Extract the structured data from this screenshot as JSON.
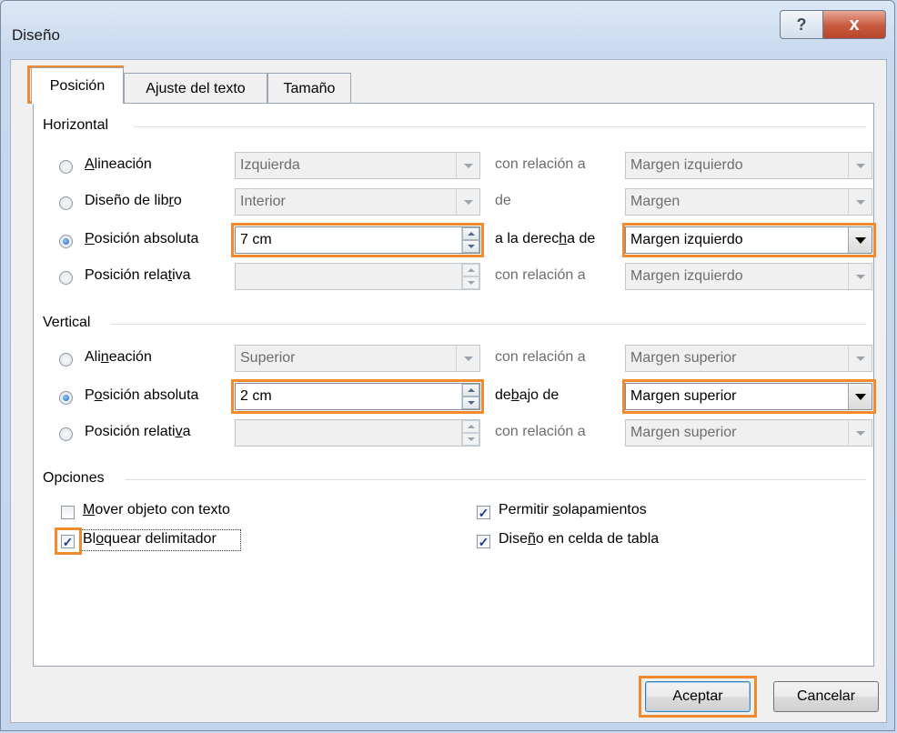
{
  "window": {
    "title": "Diseño",
    "help_label": "?",
    "close_label": "x"
  },
  "tabs": [
    {
      "label": "Posición",
      "active": true
    },
    {
      "label": "Ajuste del texto",
      "active": false
    },
    {
      "label": "Tamaño",
      "active": false
    }
  ],
  "horizontal": {
    "label": "Horizontal",
    "rows": [
      {
        "option": "Alineación",
        "selected": false,
        "value": "Izquierda",
        "relation": "con relación a",
        "reference": "Margen izquierdo"
      },
      {
        "option": "Diseño de libro",
        "selected": false,
        "value": "Interior",
        "relation": "de",
        "reference": "Margen"
      },
      {
        "option": "Posición absoluta",
        "selected": true,
        "value": "7 cm",
        "relation": "a la derecha de",
        "reference": "Margen izquierdo"
      },
      {
        "option": "Posición relativa",
        "selected": false,
        "value": "",
        "relation": "con relación a",
        "reference": "Margen izquierdo"
      }
    ]
  },
  "vertical": {
    "label": "Vertical",
    "rows": [
      {
        "option": "Alineación",
        "selected": false,
        "value": "Superior",
        "relation": "con relación a",
        "reference": "Margen superior"
      },
      {
        "option": "Posición absoluta",
        "selected": true,
        "value": "2 cm",
        "relation": "debajo de",
        "reference": "Margen superior"
      },
      {
        "option": "Posición relativa",
        "selected": false,
        "value": "",
        "relation": "con relación a",
        "reference": "Margen superior"
      }
    ]
  },
  "options": {
    "label": "Opciones",
    "items": [
      {
        "label": "Mover objeto con texto",
        "checked": false
      },
      {
        "label": "Bloquear delimitador",
        "checked": true
      },
      {
        "label": "Permitir solapamientos",
        "checked": true
      },
      {
        "label": "Diseño en celda de tabla",
        "checked": true
      }
    ]
  },
  "buttons": {
    "ok": "Aceptar",
    "cancel": "Cancelar"
  },
  "colors": {
    "highlight": "#f08a2e",
    "radio_selected": "#1c5fb8"
  }
}
